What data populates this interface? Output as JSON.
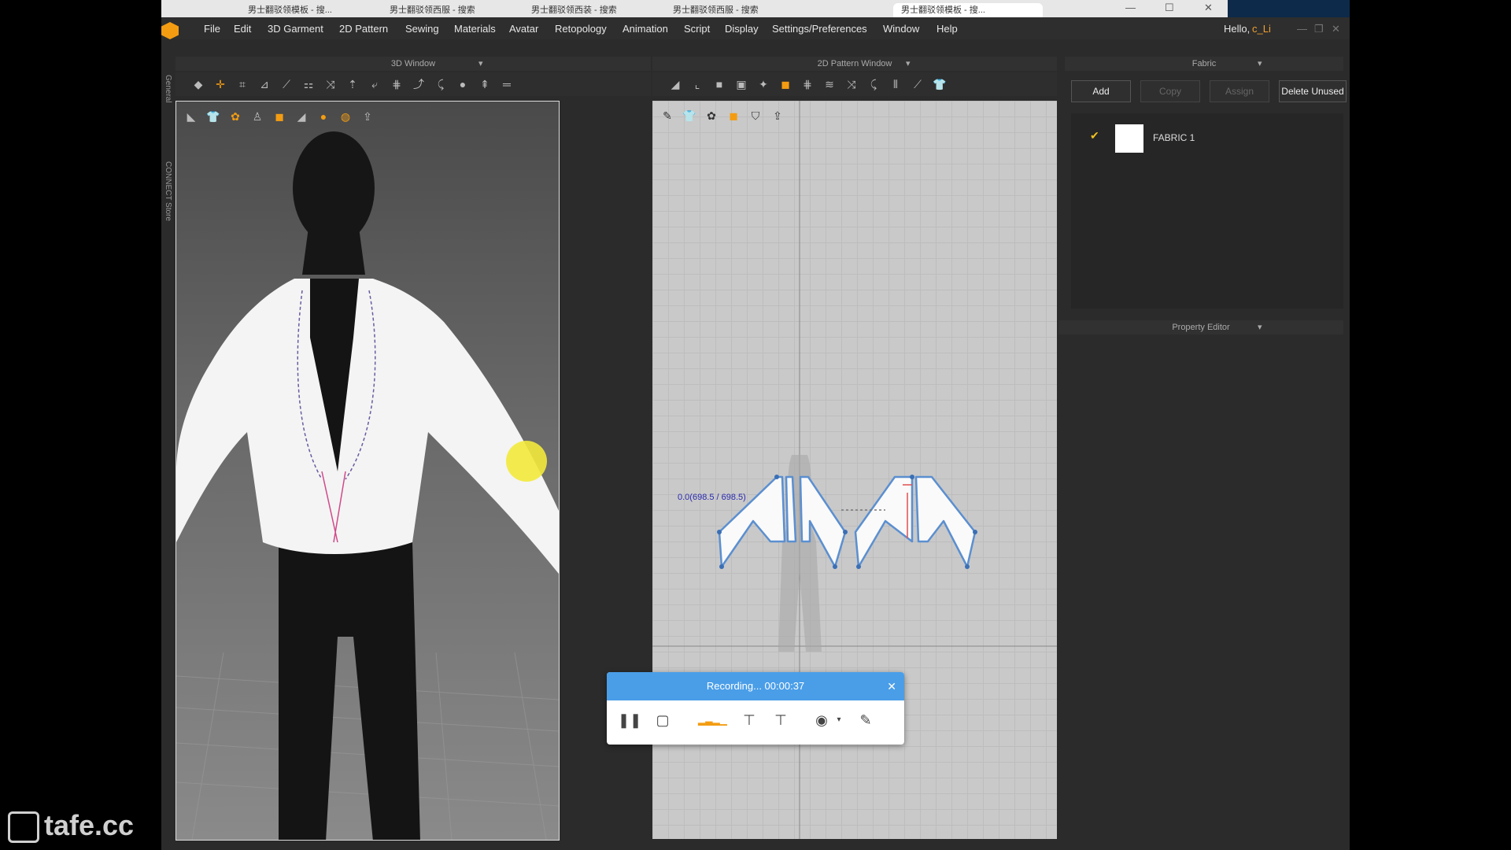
{
  "browser": {
    "tabs": [
      "男士翻驳领模板 - 搜...",
      "男士翻驳领西服 - 搜索",
      "男士翻驳领西装 - 搜索",
      "男士翻驳领西服 - 搜索",
      "男士翻驳领模板 - 搜..."
    ]
  },
  "menubar": {
    "items": [
      "File",
      "Edit",
      "3D Garment",
      "2D Pattern",
      "Sewing",
      "Materials",
      "Avatar",
      "Retopology",
      "Animation",
      "Script",
      "Display",
      "Settings/Preferences",
      "Window",
      "Help"
    ],
    "greeting": "Hello,",
    "username": "c_Li"
  },
  "side_tabs": {
    "general": "General",
    "connect": "CONNECT Store"
  },
  "window3d": {
    "title": "3D Window"
  },
  "window2d": {
    "title": "2D Pattern Window",
    "measure_label": "0.0(698.5 / 698.5)"
  },
  "fabric": {
    "title": "Fabric",
    "buttons": {
      "add": "Add",
      "copy": "Copy",
      "assign": "Assign",
      "delete_unused": "Delete Unused"
    },
    "items": [
      {
        "name": "FABRIC 1",
        "checked": true
      }
    ]
  },
  "property_editor": {
    "title": "Property Editor"
  },
  "recording": {
    "status": "Recording... 00:00:37"
  },
  "watermark": "tafe.cc",
  "colors": {
    "accent": "#f39c12",
    "recording_header": "#4a9ee8",
    "pattern_outline": "#5b8fd0",
    "username": "#f0a030"
  }
}
